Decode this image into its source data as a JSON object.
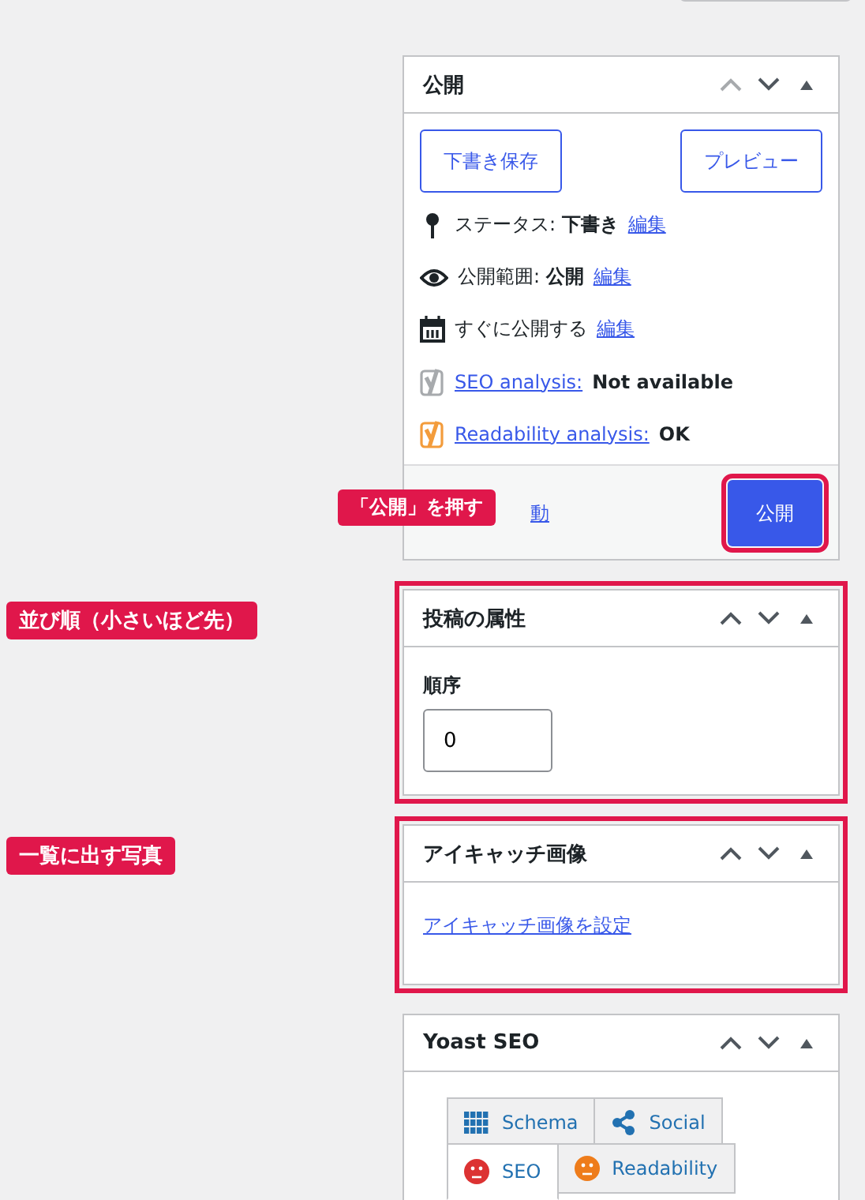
{
  "panels": [
    {
      "kind": "publish",
      "title": "公開",
      "up_disabled": true,
      "highlighted": false,
      "buttons": [
        "下書き保存",
        "プレビュー"
      ],
      "rows": [
        {
          "kind": "status",
          "label": "ステータス: ",
          "value": "下書き",
          "link": "編集"
        },
        {
          "kind": "visibility",
          "label": "公開範囲: ",
          "value": "公開",
          "link": "編集"
        },
        {
          "kind": "schedule",
          "label": "すぐに公開する",
          "link": "編集"
        },
        {
          "kind": "analysis",
          "color": "#a7aaad",
          "link": "SEO analysis:",
          "value": "Not available"
        },
        {
          "kind": "analysis",
          "color": "#f39c3c",
          "link": "Readability analysis:",
          "value": "OK"
        }
      ],
      "trash_link": "動",
      "publish_button": "公開",
      "annotation": "「公開」を押す"
    },
    {
      "kind": "attributes",
      "title": "投稿の属性",
      "up_disabled": false,
      "highlighted": true,
      "annotation": "並び順（小さいほど先）",
      "field_label": "順序",
      "value": "0"
    },
    {
      "kind": "featured",
      "title": "アイキャッチ画像",
      "up_disabled": false,
      "highlighted": true,
      "annotation": "一覧に出す写真",
      "link": "アイキャッチ画像を設定"
    },
    {
      "kind": "yoast",
      "title": "Yoast SEO",
      "up_disabled": false,
      "highlighted": false,
      "tab_rows": [
        [
          {
            "kind": "schema",
            "label": "Schema",
            "selected": false
          },
          {
            "kind": "social",
            "label": "Social",
            "selected": false
          }
        ],
        [
          {
            "kind": "score",
            "label": "SEO",
            "color": "#dc3232",
            "selected": true
          },
          {
            "kind": "score",
            "label": "Readability",
            "color": "#ee7c1b",
            "selected": false
          }
        ]
      ]
    }
  ]
}
